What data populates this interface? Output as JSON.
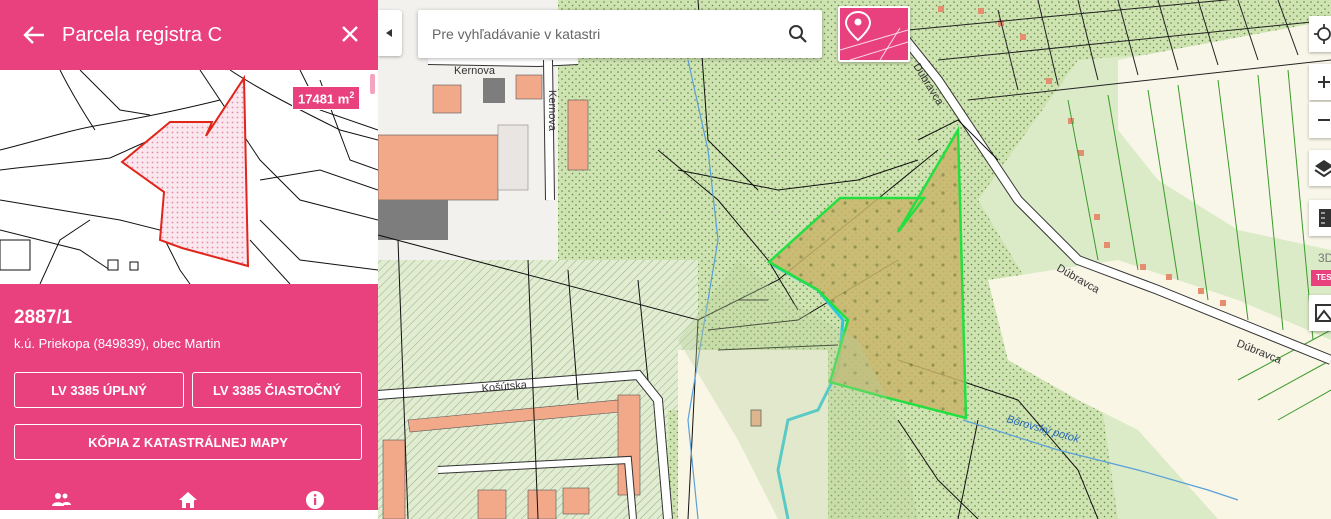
{
  "panel": {
    "title": "Parcela registra C",
    "area_value": "17481 m",
    "area_unit_exp": "2",
    "parcel_number": "2887/1",
    "location": "k.ú. Priekopa (849839), obec Martin",
    "buttons": {
      "lv_full": "LV 3385 ÚPLNÝ",
      "lv_partial": "LV 3385 ČIASTOČNÝ",
      "copy_map": "KÓPIA Z KATASTRÁLNEJ MAPY"
    },
    "bottom_icons": [
      "people-icon",
      "home-icon",
      "info-icon"
    ]
  },
  "search": {
    "placeholder": "Pre vyhľadávanie v katastri"
  },
  "map": {
    "street_labels": [
      "Kernova",
      "Kernova",
      "Košútska",
      "Dúbravca",
      "Dúbravca",
      "Dúbravca"
    ],
    "stream_label": "Bôrovský potok",
    "controls": {
      "label_3d": "3D",
      "badge_tes": "TES"
    }
  },
  "colors": {
    "accent": "#e9417d",
    "parcel_outline": "#22e040",
    "parcel_fill": "#d9b86a",
    "building": "#f2a98a",
    "forest": "#c8e0a8"
  }
}
